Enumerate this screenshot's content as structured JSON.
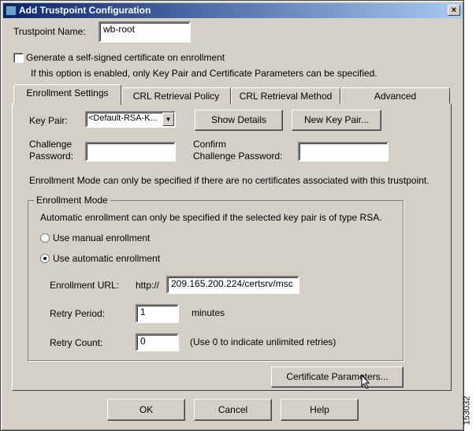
{
  "window": {
    "title": "Add Trustpoint Configuration",
    "close": "×"
  },
  "trustpoint_name": {
    "label": "Trustpoint Name:",
    "value": "wb-root"
  },
  "self_signed": {
    "label": "Generate a self-signed certificate on enrollment",
    "checked": false,
    "hint": "If this option is enabled, only Key Pair and Certificate Parameters can be specified."
  },
  "tabs": [
    {
      "label": "Enrollment Settings",
      "active": true
    },
    {
      "label": "CRL Retrieval Policy"
    },
    {
      "label": "CRL Retrieval Method"
    },
    {
      "label": "Advanced"
    }
  ],
  "enrollment": {
    "key_pair_label": "Key Pair:",
    "key_pair_value": "<Default-RSA-K...",
    "show_details": "Show Details",
    "new_key_pair": "New Key Pair...",
    "challenge_label1": "Challenge",
    "challenge_label2": "Password:",
    "confirm_label1": "Confirm",
    "confirm_label2": "Challenge Password:",
    "mode_note": "Enrollment Mode can only be specified if there are no certificates associated with this trustpoint.",
    "group_title": "Enrollment Mode",
    "auto_note": "Automatic enrollment can only be specified if the selected key pair is of type RSA.",
    "manual_label": "Use manual enrollment",
    "auto_label": "Use automatic enrollment",
    "selected_mode": "automatic",
    "url_label": "Enrollment URL:",
    "url_prefix": "http://",
    "url_value": "209.165.200.224/certsrv/msc",
    "retry_period_label": "Retry Period:",
    "retry_period_value": "1",
    "retry_period_unit": "minutes",
    "retry_count_label": "Retry Count:",
    "retry_count_value": "0",
    "retry_count_note": "(Use 0 to indicate unlimited retries)",
    "cert_params": "Certificate Parameters..."
  },
  "buttons": {
    "ok": "OK",
    "cancel": "Cancel",
    "help": "Help"
  },
  "figure_number": "153032"
}
